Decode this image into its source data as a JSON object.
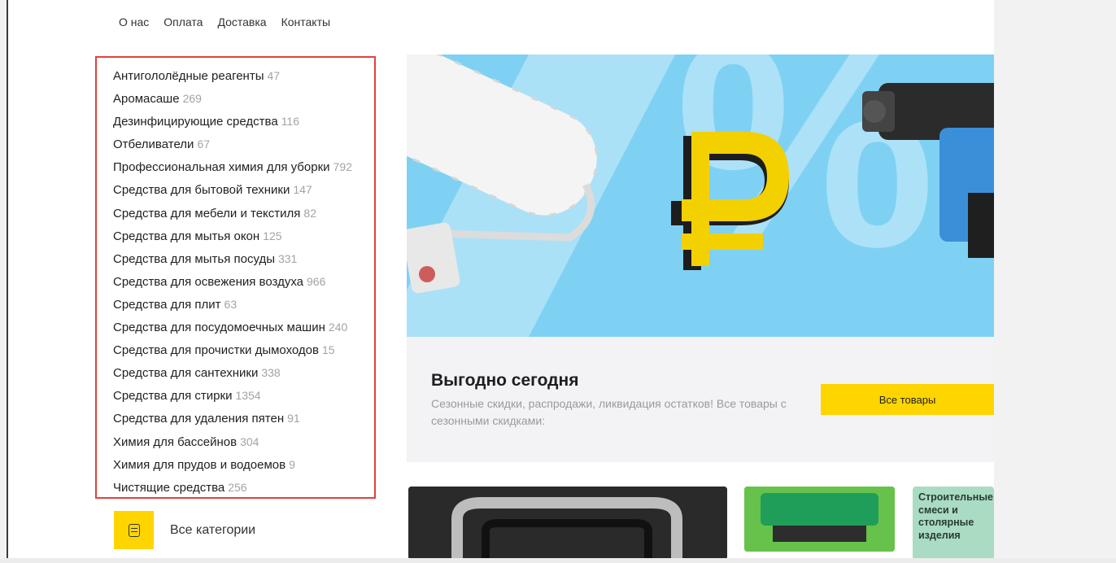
{
  "nav": [
    "О нас",
    "Оплата",
    "Доставка",
    "Контакты"
  ],
  "categories": [
    {
      "name": "Антигололёдные реагенты",
      "count": "47"
    },
    {
      "name": "Аромасаше",
      "count": "269"
    },
    {
      "name": "Дезинфицирующие средства",
      "count": "116"
    },
    {
      "name": "Отбеливатели",
      "count": "67"
    },
    {
      "name": "Профессиональная химия для уборки",
      "count": "792"
    },
    {
      "name": "Средства для бытовой техники",
      "count": "147"
    },
    {
      "name": "Средства для мебели и текстиля",
      "count": "82"
    },
    {
      "name": "Средства для мытья окон",
      "count": "125"
    },
    {
      "name": "Средства для мытья посуды",
      "count": "331"
    },
    {
      "name": "Средства для освежения воздуха",
      "count": "966"
    },
    {
      "name": "Средства для плит",
      "count": "63"
    },
    {
      "name": "Средства для посудомоечных машин",
      "count": "240"
    },
    {
      "name": "Средства для прочистки дымоходов",
      "count": "15"
    },
    {
      "name": "Средства для сантехники",
      "count": "338"
    },
    {
      "name": "Средства для стирки",
      "count": "1354"
    },
    {
      "name": "Средства для удаления пятен",
      "count": "91"
    },
    {
      "name": "Химия для бассейнов",
      "count": "304"
    },
    {
      "name": "Химия для прудов и водоемов",
      "count": "9"
    },
    {
      "name": "Чистящие средства",
      "count": "256"
    }
  ],
  "all_categories_label": "Все категории",
  "promo": {
    "title": "Выгодно сегодня",
    "text": "Сезонные скидки, распродажи, ликвидация остатков! Все товары с сезонными скидками:",
    "button": "Все товары"
  },
  "tiles": {
    "tile3_text": "Строительные смеси и столярные изделия"
  },
  "colors": {
    "accent": "#ffd500",
    "banner_bg": "#7fd1f3",
    "highlight_border": "#e2403f",
    "count_text": "#a3a3a3"
  }
}
